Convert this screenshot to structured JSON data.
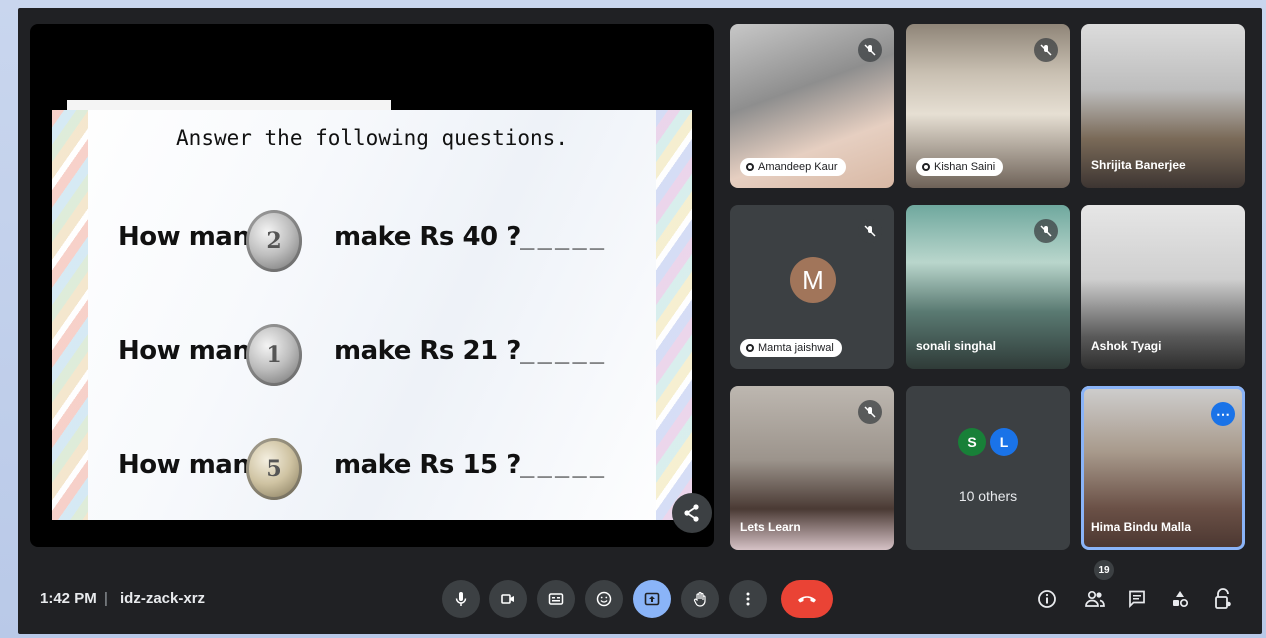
{
  "presentation": {
    "slide_title": "Answer the following questions.",
    "questions": [
      {
        "left": "How many",
        "coin_label": "2",
        "right": "make Rs 40 ?",
        "blank": "_____"
      },
      {
        "left": "How many",
        "coin_label": "1",
        "right": "make Rs 21 ?",
        "blank": "_____"
      },
      {
        "left": "How many",
        "coin_label": "5",
        "right": "make Rs 15 ?",
        "blank": "_____"
      }
    ],
    "share_icon": "share-icon"
  },
  "participants": [
    {
      "name": "Amandeep Kaur",
      "muted": true,
      "style": "pill"
    },
    {
      "name": "Kishan Saini",
      "muted": true,
      "style": "pill"
    },
    {
      "name": "Shrijita Banerjee",
      "muted": false,
      "style": "plain"
    },
    {
      "name": "Mamta jaishwal",
      "avatar_letter": "M",
      "muted": true,
      "style": "pill"
    },
    {
      "name": "sonali singhal",
      "muted": true,
      "style": "plain"
    },
    {
      "name": "Ashok Tyagi",
      "muted": false,
      "style": "plain"
    },
    {
      "name": "Lets Learn",
      "muted": true,
      "style": "plain"
    },
    {
      "name": "Hima Bindu Malla",
      "muted": false,
      "style": "plain",
      "highlighted": true
    }
  ],
  "others_tile": {
    "avatars": [
      "S",
      "L"
    ],
    "label": "10 others"
  },
  "bottom_bar": {
    "time": "1:42 PM",
    "separator": "|",
    "meeting_code": "idz-zack-xrz",
    "people_count": "19"
  },
  "colors": {
    "background": "#202124",
    "tile": "#3c4043",
    "active": "#8ab4f8",
    "leave": "#ea4335",
    "accent": "#1a73e8"
  }
}
